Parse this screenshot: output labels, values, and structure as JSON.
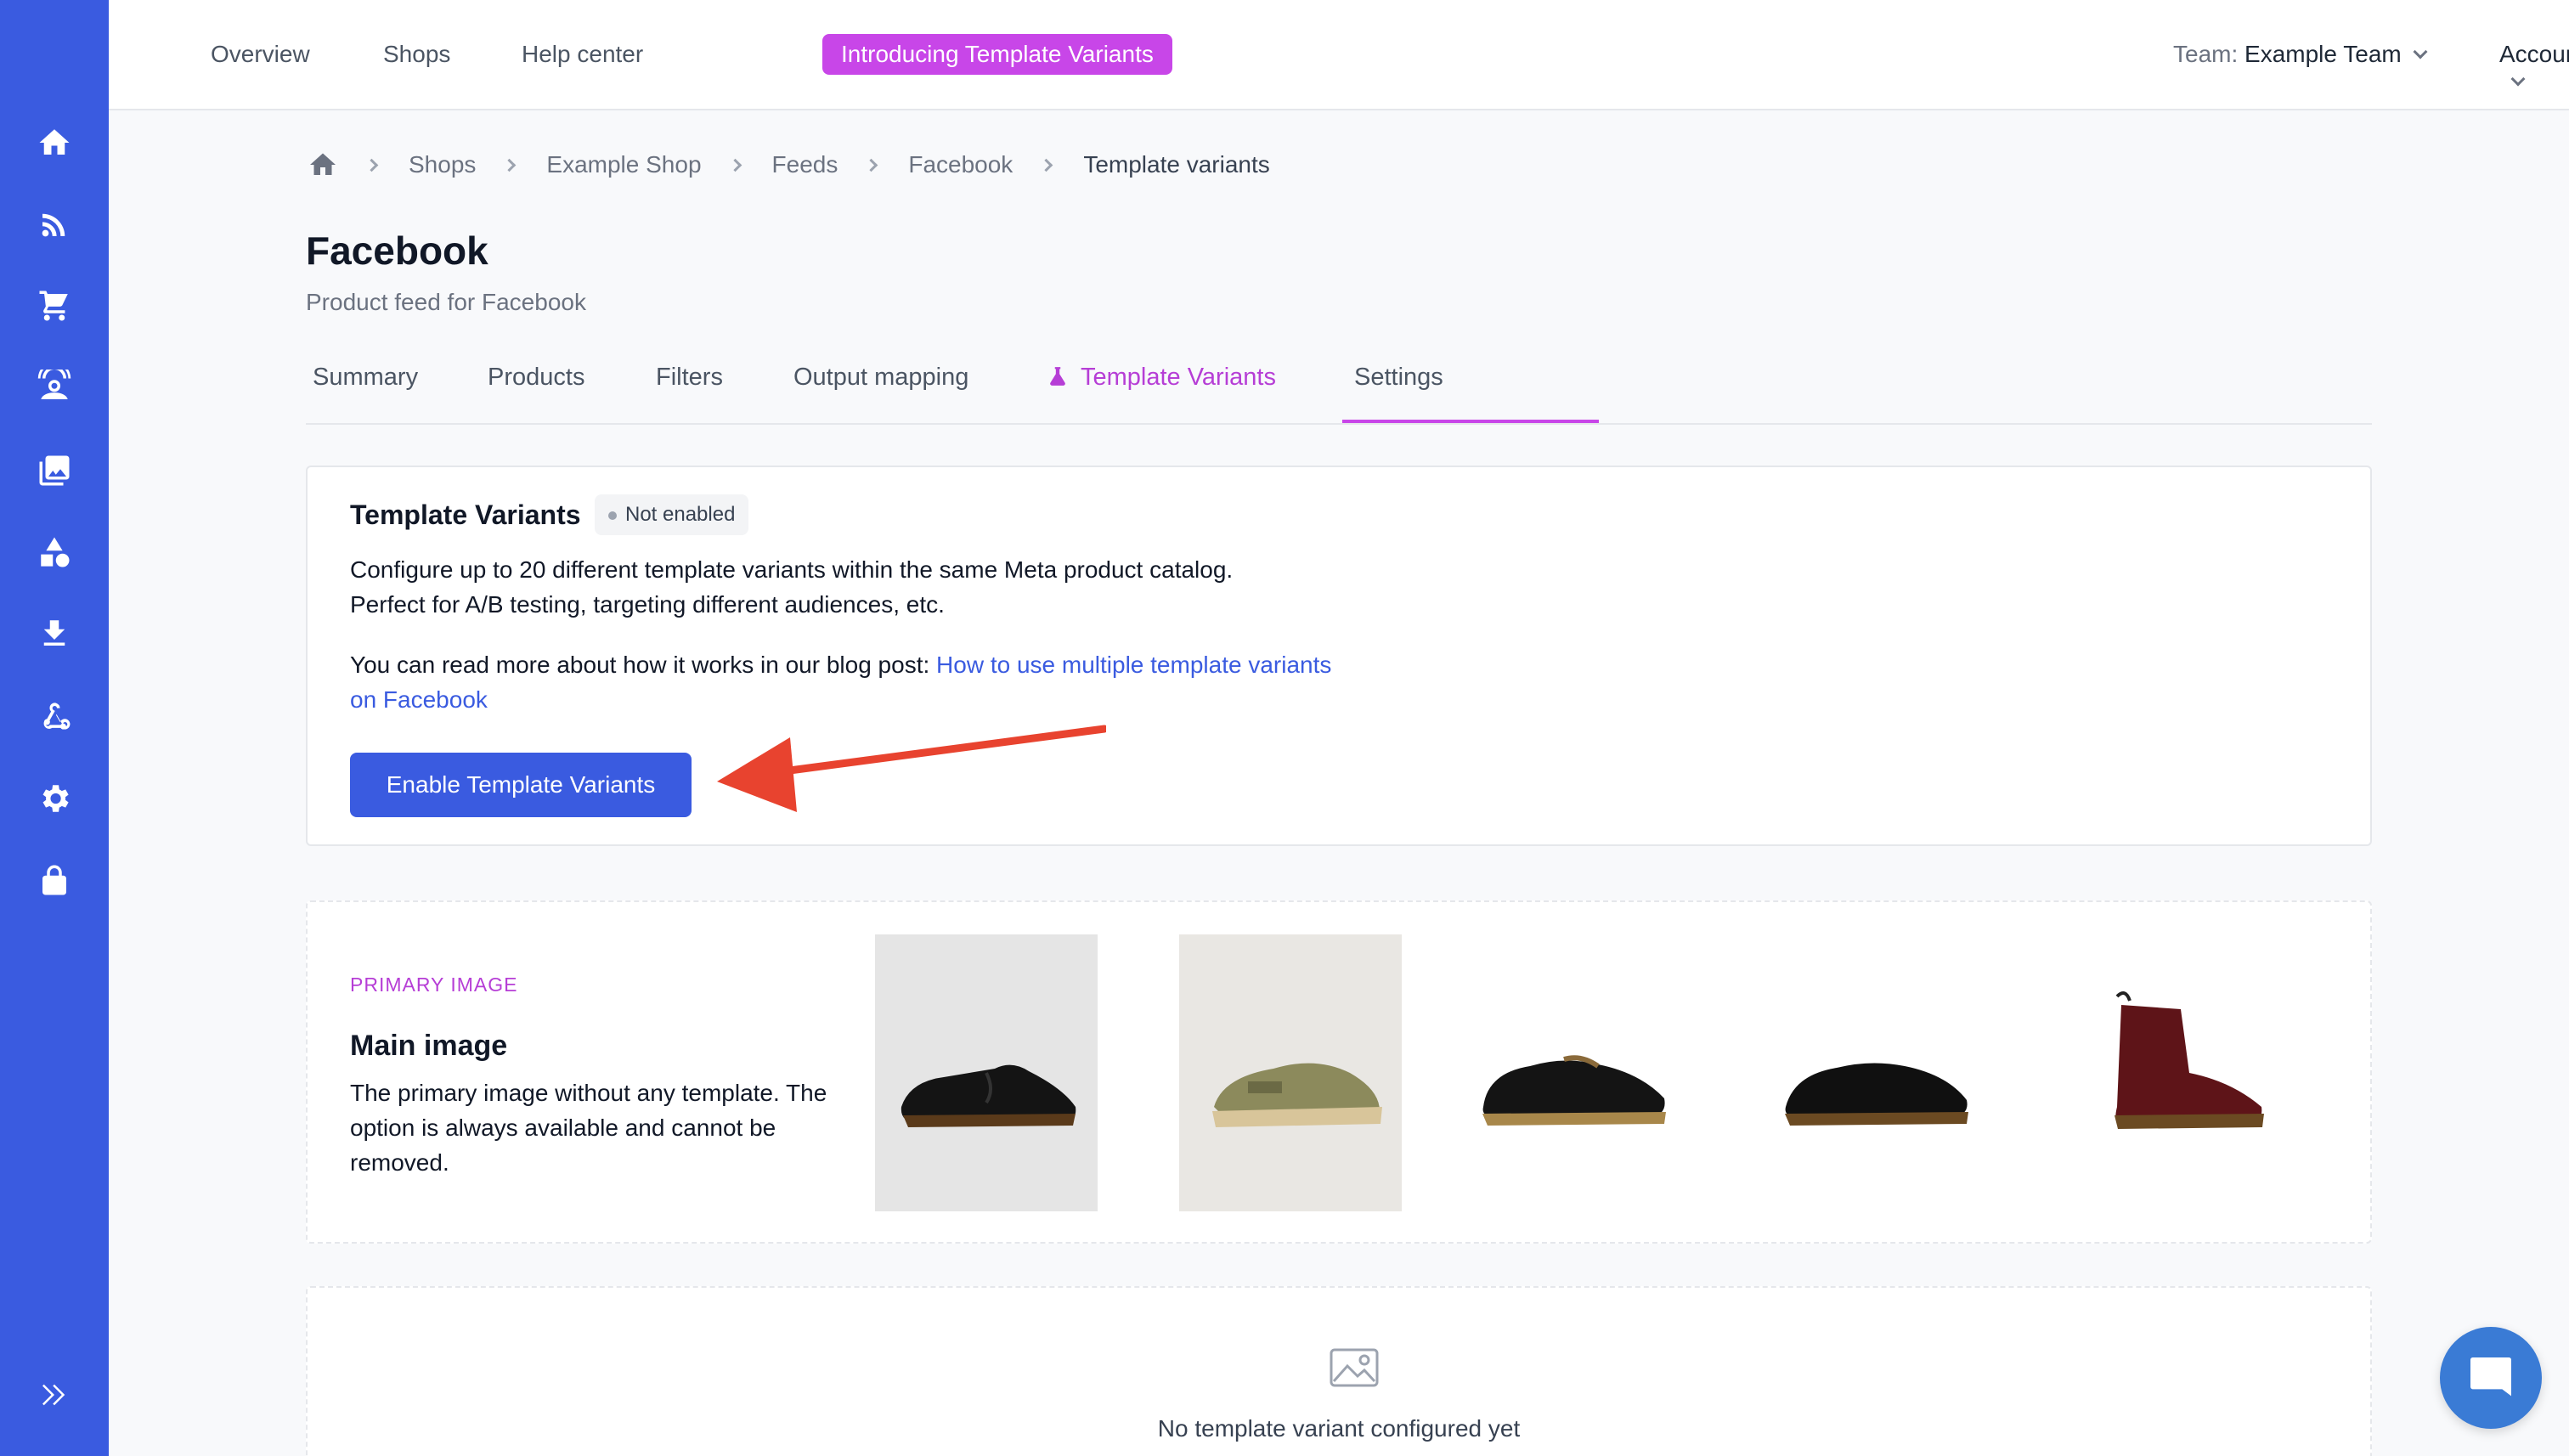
{
  "topnav": {
    "overview": "Overview",
    "shops": "Shops",
    "help": "Help center",
    "promo": "Introducing Template Variants",
    "team_label": "Team:",
    "team_name": "Example Team",
    "account": "Account"
  },
  "sidebar": {
    "icons": [
      "home-icon",
      "feed-icon",
      "cart-icon",
      "channels-icon",
      "images-icon",
      "shapes-icon",
      "download-icon",
      "webhook-icon",
      "settings-icon",
      "lock-icon"
    ],
    "expand_icon": "expand-icon"
  },
  "breadcrumb": {
    "items": [
      "Shops",
      "Example Shop",
      "Feeds",
      "Facebook",
      "Template variants"
    ]
  },
  "page": {
    "title": "Facebook",
    "subtitle": "Product feed for Facebook"
  },
  "tabs": [
    "Summary",
    "Products",
    "Filters",
    "Output mapping",
    "Template Variants",
    "Settings"
  ],
  "active_tab": "Template Variants",
  "template_card": {
    "title": "Template Variants",
    "badge": "Not enabled",
    "line1": "Configure up to 20 different template variants within the same Meta product catalog.",
    "line2": "Perfect for A/B testing, targeting different audiences, etc.",
    "read_more": "You can read more about how it works in our blog post: ",
    "link_text": "How to use multiple template variants on Facebook",
    "button": "Enable Template Variants"
  },
  "primary_card": {
    "label": "PRIMARY IMAGE",
    "title": "Main image",
    "description": "The primary image without any template. The option is always available and cannot be removed.",
    "products": [
      "loafer",
      "clog",
      "derby-shoe",
      "derby-shoe-smooth",
      "boot-cherry-red"
    ]
  },
  "empty_card": {
    "text": "No template variant configured yet"
  },
  "colors": {
    "primary": "#3a5be0",
    "accent": "#c846e8",
    "arrow": "#e8432f"
  }
}
